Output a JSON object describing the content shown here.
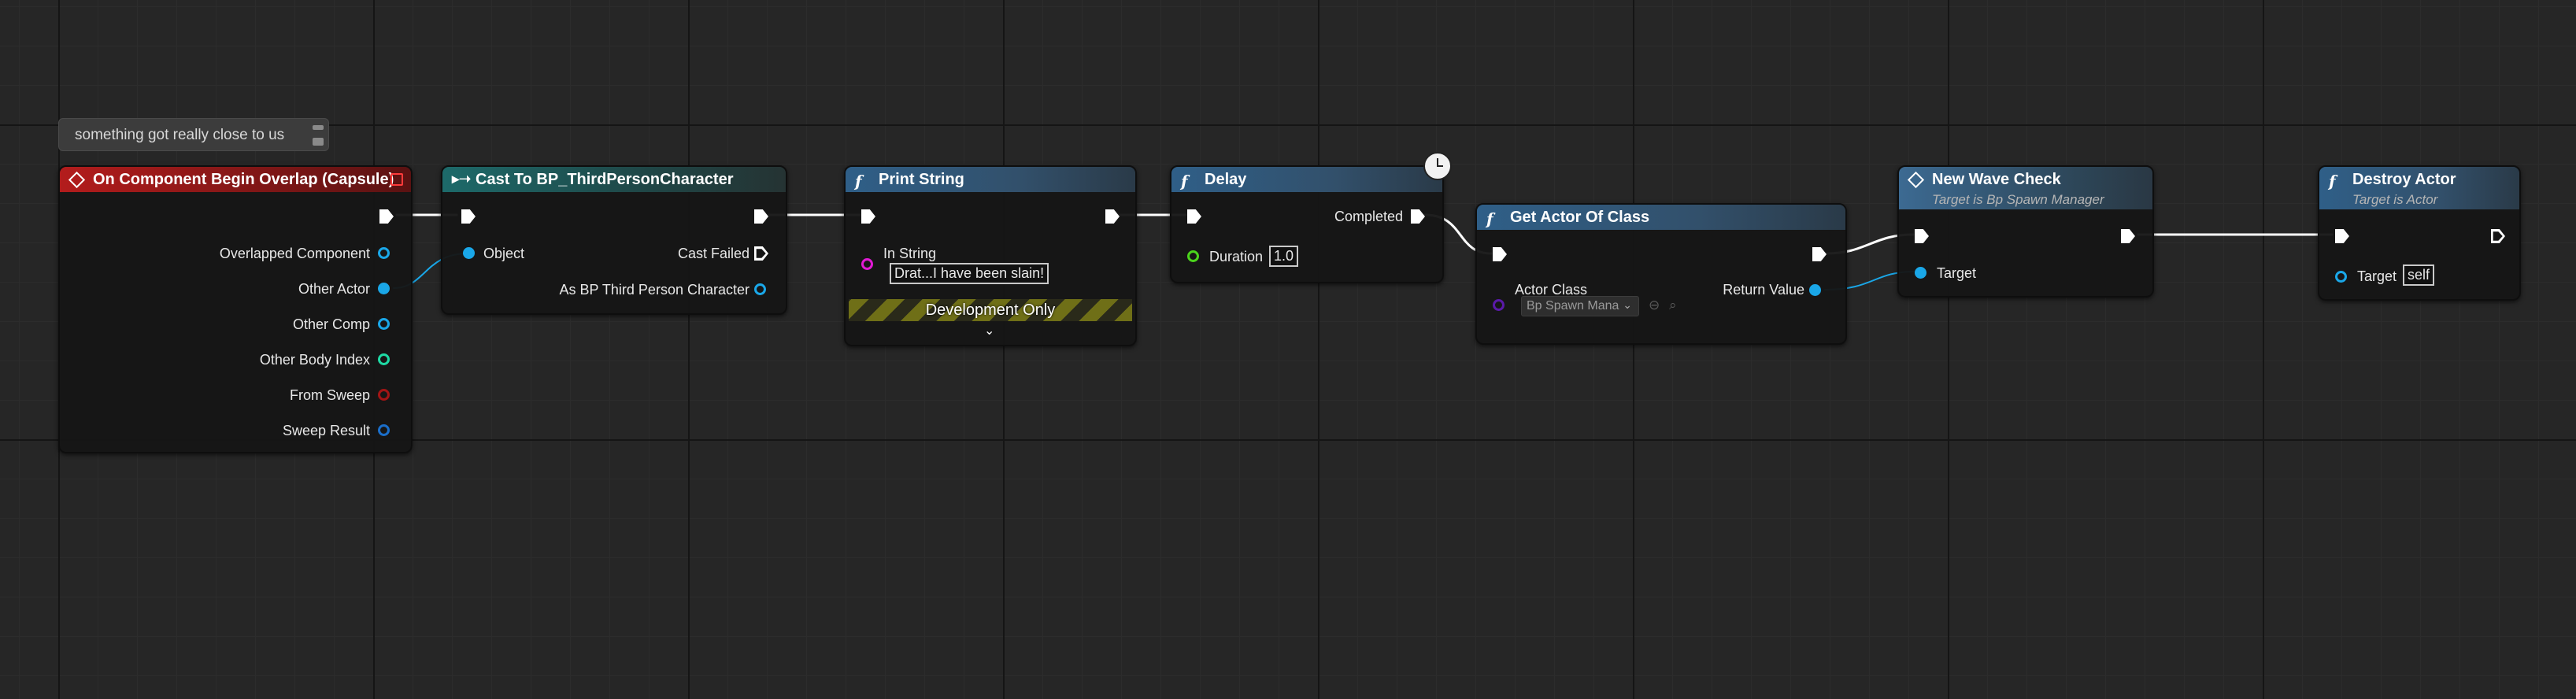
{
  "comment": {
    "text": "something got really close to us"
  },
  "nodes": {
    "overlap": {
      "title": "On Component Begin Overlap (Capsule)",
      "pins": [
        "Overlapped Component",
        "Other Actor",
        "Other Comp",
        "Other Body Index",
        "From Sweep",
        "Sweep Result"
      ]
    },
    "cast": {
      "title": "Cast To BP_ThirdPersonCharacter",
      "object_label": "Object",
      "cast_failed_label": "Cast Failed",
      "as_label": "As BP Third Person Character"
    },
    "print": {
      "title": "Print String",
      "in_string_label": "In String",
      "in_string_value": "Drat...I have been slain!",
      "dev_only": "Development Only",
      "expand_glyph": "⌄"
    },
    "delay": {
      "title": "Delay",
      "completed_label": "Completed",
      "duration_label": "Duration",
      "duration_value": "1.0"
    },
    "getactor": {
      "title": "Get Actor Of Class",
      "actor_class_label": "Actor Class",
      "actor_class_value": "Bp Spawn Mana",
      "return_label": "Return Value"
    },
    "wave": {
      "title": "New Wave Check",
      "subtitle": "Target is Bp Spawn Manager",
      "target_label": "Target"
    },
    "destroy": {
      "title": "Destroy Actor",
      "subtitle": "Target is Actor",
      "target_label": "Target",
      "target_value": "self"
    }
  },
  "colors": {
    "object_pin": "#1aa7e8",
    "int_pin": "#1ed9a4",
    "bool_pin": "#a21515",
    "struct_pin": "#1b6ec9",
    "string_pin": "#e11ad5",
    "float_pin": "#4bd41c",
    "class_pin": "#5a1aa8",
    "exec_wire": "#ffffff"
  },
  "icons": {
    "function": "f",
    "event": "event-diamond-icon",
    "cast": "cast-arrow-icon",
    "clock": "clock-icon",
    "select_caret": "⌄",
    "use_selected": "arrow-circle-icon",
    "browse": "magnifier-icon"
  }
}
